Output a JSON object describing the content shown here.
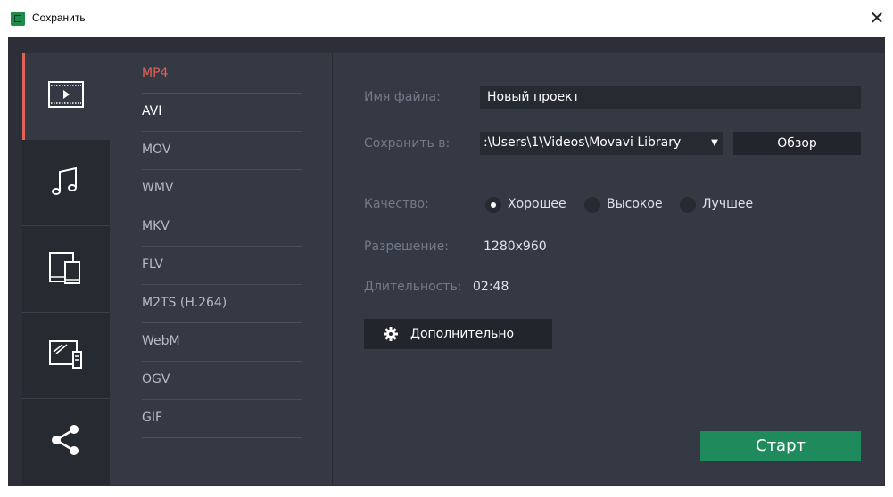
{
  "window": {
    "title": "Сохранить",
    "close_glyph": "✕"
  },
  "tabs": [
    {
      "name": "video-icon"
    },
    {
      "name": "music-icon"
    },
    {
      "name": "devices-icon"
    },
    {
      "name": "tv-icon"
    },
    {
      "name": "share-icon"
    }
  ],
  "formats": [
    "MP4",
    "AVI",
    "MOV",
    "WMV",
    "MKV",
    "FLV",
    "M2TS (H.264)",
    "WebM",
    "OGV",
    "GIF"
  ],
  "form": {
    "filename_label": "Имя файла:",
    "filename_value": "Новый проект",
    "save_to_label": "Сохранить в:",
    "save_to_value": ":\\Users\\1\\Videos\\Movavi Library",
    "browse_label": "Обзор",
    "quality_label": "Качество:",
    "quality_options": [
      "Хорошее",
      "Высокое",
      "Лучшее"
    ],
    "quality_selected": "Хорошее",
    "resolution_label": "Разрешение:",
    "resolution_value": "1280x960",
    "duration_label": "Длительность:",
    "duration_value": "02:48",
    "advanced_label": "Дополнительно",
    "start_label": "Старт"
  },
  "colors": {
    "accent": "#e2625a",
    "start": "#1f8a5b",
    "panel": "#343944",
    "sidebar": "#262a31"
  }
}
